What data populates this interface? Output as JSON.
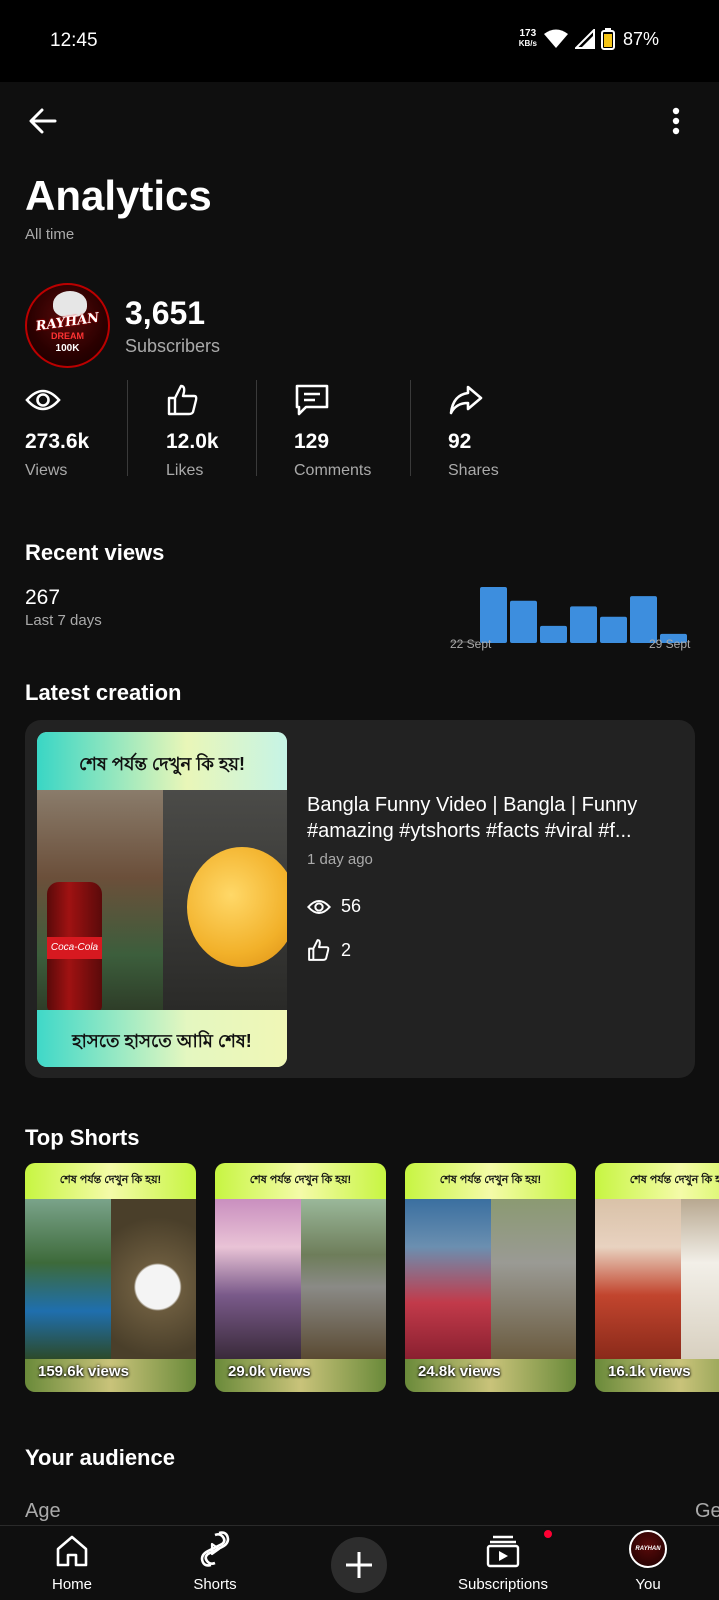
{
  "status_bar": {
    "time": "12:45",
    "net_speed": "173",
    "net_unit": "KB/s",
    "battery": "87%"
  },
  "header": {
    "title": "Analytics",
    "subtitle": "All time"
  },
  "channel": {
    "avatar_text_1": "RAYHAN",
    "avatar_text_2": "DREAM",
    "avatar_text_3": "100K",
    "subscribers": "3,651",
    "subscribers_label": "Subscribers"
  },
  "stats": [
    {
      "icon": "eye-icon",
      "value": "273.6k",
      "label": "Views"
    },
    {
      "icon": "thumbs-up-icon",
      "value": "12.0k",
      "label": "Likes"
    },
    {
      "icon": "comment-icon",
      "value": "129",
      "label": "Comments"
    },
    {
      "icon": "share-icon",
      "value": "92",
      "label": "Shares"
    }
  ],
  "recent_views": {
    "title": "Recent views",
    "value": "267",
    "label": "Last 7 days",
    "chart_start_label": "22 Sept",
    "chart_end_label": "29 Sept"
  },
  "chart_data": {
    "type": "bar",
    "categories": [
      "22 Sept",
      "23",
      "24",
      "25",
      "26",
      "27",
      "28",
      "29 Sept"
    ],
    "values": [
      1,
      49,
      37,
      15,
      32,
      23,
      41,
      8
    ],
    "color": "#3d8ede"
  },
  "latest": {
    "title": "Latest creation",
    "thumb_top_text": "শেষ পর্যন্ত দেখুন কি হয়!",
    "thumb_bottom_text": "হাসতে হাসতে আমি শেষ!",
    "bottle_text": "Coca-Cola",
    "video_title_line1": "Bangla Funny Video | Bangla | Funny",
    "video_title_line2": "#amazing #ytshorts #facts #viral #f...",
    "age": "1 day ago",
    "views": "56",
    "likes": "2"
  },
  "top_shorts": {
    "title": "Top Shorts",
    "band_text": "শেষ পর্যন্ত দেখুন কি হয়!",
    "items": [
      {
        "views": "159.6k views"
      },
      {
        "views": "29.0k views"
      },
      {
        "views": "24.8k views"
      },
      {
        "views": "16.1k views"
      }
    ]
  },
  "audience": {
    "title": "Your audience",
    "age_label": "Age",
    "gender_label_partial": "Ge"
  },
  "nav": {
    "home": "Home",
    "shorts": "Shorts",
    "subscriptions": "Subscriptions",
    "you": "You",
    "you_avatar_text": "RAYHAN"
  },
  "colors": {
    "background": "#0f0f0f",
    "card": "#222222",
    "accent_bar": "#3d8ede",
    "notification": "#ff0033"
  }
}
